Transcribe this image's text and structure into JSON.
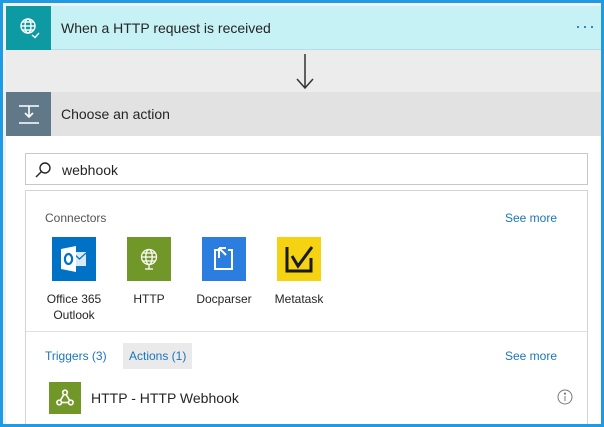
{
  "trigger": {
    "title": "When a HTTP request is received",
    "icon": "globe-request-icon",
    "more_label": "···"
  },
  "action_step": {
    "title": "Choose an action",
    "icon": "choose-action-icon"
  },
  "search": {
    "value": "webhook",
    "placeholder": ""
  },
  "connectors": {
    "section_label": "Connectors",
    "see_more_label": "See more",
    "items": [
      {
        "label_line1": "Office 365",
        "label_line2": "Outlook",
        "icon": "outlook-icon",
        "color": "#0072c6"
      },
      {
        "label_line1": "HTTP",
        "label_line2": "",
        "icon": "http-globe-icon",
        "color": "#709727"
      },
      {
        "label_line1": "Docparser",
        "label_line2": "",
        "icon": "docparser-icon",
        "color": "#2b7de0"
      },
      {
        "label_line1": "Metatask",
        "label_line2": "",
        "icon": "metatask-check-icon",
        "color": "#f5d313"
      }
    ]
  },
  "filters": {
    "triggers_label": "Triggers (3)",
    "actions_label": "Actions (1)",
    "see_more_label": "See more"
  },
  "results": [
    {
      "label": "HTTP - HTTP Webhook",
      "icon": "webhook-icon",
      "color": "#709727"
    }
  ],
  "colors": {
    "accent": "#1e9be3",
    "link": "#1b75bb",
    "trigger_bg": "#c6f1f5",
    "trigger_icon_bg": "#0d9aa3",
    "action_icon_bg": "#607888"
  }
}
